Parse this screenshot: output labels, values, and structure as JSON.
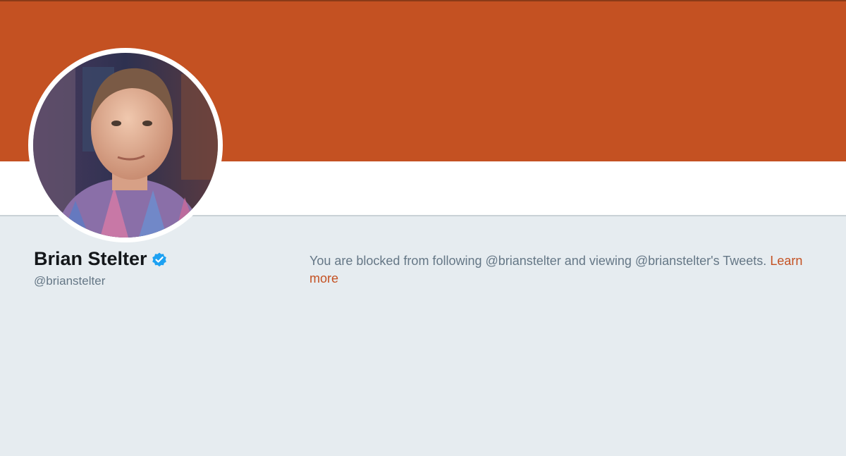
{
  "profile": {
    "name": "Brian Stelter",
    "handle": "@brianstelter",
    "verified": true
  },
  "notice": {
    "text": "You are blocked from following @brianstelter and viewing @brianstelter's Tweets.",
    "link_label": "Learn more"
  },
  "colors": {
    "banner": "#c45122",
    "link": "#c45122",
    "page_background": "#e6ecf0",
    "verified_badge": "#1da1f2"
  }
}
